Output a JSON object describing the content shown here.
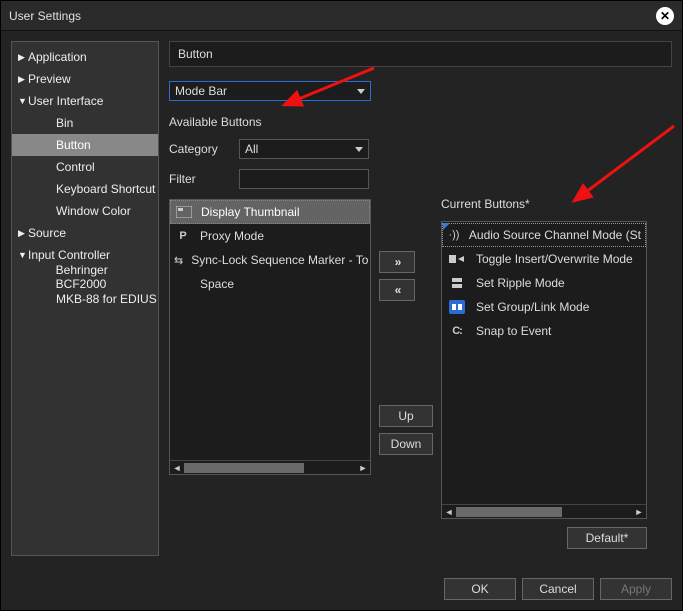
{
  "window": {
    "title": "User Settings"
  },
  "sidebar": {
    "items": [
      {
        "label": "Application",
        "expandable": true,
        "expanded": false,
        "level": 1
      },
      {
        "label": "Preview",
        "expandable": true,
        "expanded": false,
        "level": 1
      },
      {
        "label": "User Interface",
        "expandable": true,
        "expanded": true,
        "level": 1
      },
      {
        "label": "Bin",
        "level": 2
      },
      {
        "label": "Button",
        "level": 2,
        "selected": true
      },
      {
        "label": "Control",
        "level": 2
      },
      {
        "label": "Keyboard Shortcut",
        "level": 2
      },
      {
        "label": "Window Color",
        "level": 2
      },
      {
        "label": "Source",
        "expandable": true,
        "expanded": false,
        "level": 1
      },
      {
        "label": "Input Controller",
        "expandable": true,
        "expanded": true,
        "level": 1
      },
      {
        "label": "Behringer BCF2000",
        "level": 2
      },
      {
        "label": "MKB-88 for EDIUS",
        "level": 2
      }
    ]
  },
  "main": {
    "section_title": "Button",
    "mode_dropdown": "Mode Bar",
    "available_label": "Available Buttons",
    "category_label": "Category",
    "category_value": "All",
    "filter_label": "Filter",
    "filter_value": "",
    "available_items": [
      {
        "icon": "thumbnail",
        "label": "Display Thumbnail",
        "selected": true
      },
      {
        "icon": "proxy",
        "label": "Proxy Mode"
      },
      {
        "icon": "sync",
        "label": "Sync-Lock Sequence Marker - To"
      },
      {
        "icon": "",
        "label": "Space"
      }
    ],
    "move_right": "»",
    "move_left": "«",
    "up_label": "Up",
    "down_label": "Down",
    "current_label": "Current Buttons*",
    "current_items": [
      {
        "icon": "audio",
        "label": "Audio Source Channel Mode (St"
      },
      {
        "icon": "toggle",
        "label": "Toggle Insert/Overwrite Mode"
      },
      {
        "icon": "ripple",
        "label": "Set Ripple Mode"
      },
      {
        "icon": "group",
        "label": "Set Group/Link Mode"
      },
      {
        "icon": "snap",
        "label": "Snap to Event"
      }
    ],
    "default_label": "Default*"
  },
  "footer": {
    "ok": "OK",
    "cancel": "Cancel",
    "apply": "Apply"
  }
}
